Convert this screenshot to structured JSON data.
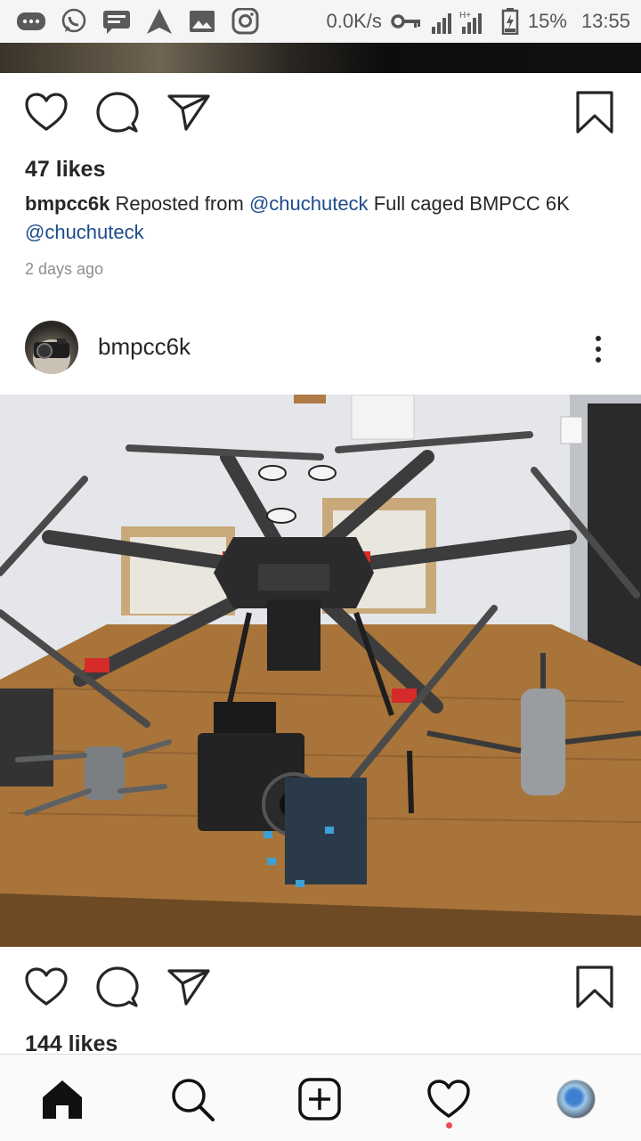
{
  "status_bar": {
    "net_speed": "0.0K/s",
    "network_type": "H+",
    "battery": "15%",
    "time": "13:55",
    "icons": [
      "messenger-icon",
      "whatsapp-icon",
      "message-icon",
      "navigation-icon",
      "gallery-icon",
      "instagram-icon",
      "key-icon",
      "signal-icon",
      "battery-icon"
    ]
  },
  "post1": {
    "likes": "47 likes",
    "username": "bmpcc6k",
    "caption_a": "Reposted from",
    "mention1": "@chuchuteck",
    "caption_b": "Full caged BMPCC 6K",
    "mention2": "@chuchuteck",
    "time_ago": "2 days ago"
  },
  "post2": {
    "username": "bmpcc6k",
    "likes": "144 likes"
  },
  "colors": {
    "mention": "#1c4c8c",
    "text": "#262626",
    "muted": "#8e8e8e",
    "notification": "#ed4956"
  },
  "nav": [
    "home-icon",
    "search-icon",
    "add-post-icon",
    "activity-icon",
    "profile-avatar"
  ]
}
